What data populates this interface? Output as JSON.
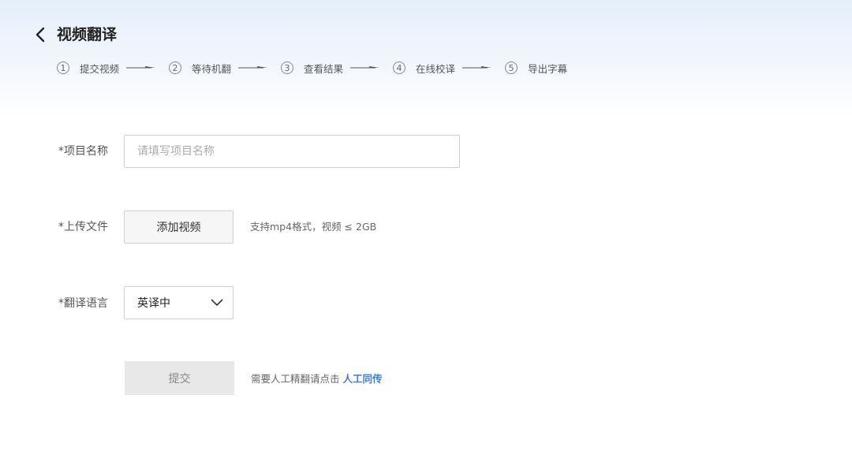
{
  "header": {
    "title": "视频翻译",
    "back_icon": "chevron-left-icon"
  },
  "steps": [
    {
      "number": "1",
      "label": "提交视频"
    },
    {
      "number": "2",
      "label": "等待机翻"
    },
    {
      "number": "3",
      "label": "查看结果"
    },
    {
      "number": "4",
      "label": "在线校译"
    },
    {
      "number": "5",
      "label": "导出字幕"
    }
  ],
  "form": {
    "project_name": {
      "label": "*项目名称",
      "value": "",
      "placeholder": "请填写项目名称"
    },
    "upload": {
      "label": "*上传文件",
      "button_label": "添加视频",
      "hint": "支持mp4格式，视频 ≤ 2GB"
    },
    "language": {
      "label": "*翻译语言",
      "selected": "英译中",
      "icon": "chevron-down-icon"
    },
    "submit": {
      "button_label": "提交",
      "hint": "需要人工精翻请点击",
      "link_label": "人工同传"
    }
  },
  "colors": {
    "header_gradient_top": "#e4effb",
    "link": "#3a7be6",
    "submit_bg": "#e8e8e8",
    "border": "#cfcfcf"
  }
}
